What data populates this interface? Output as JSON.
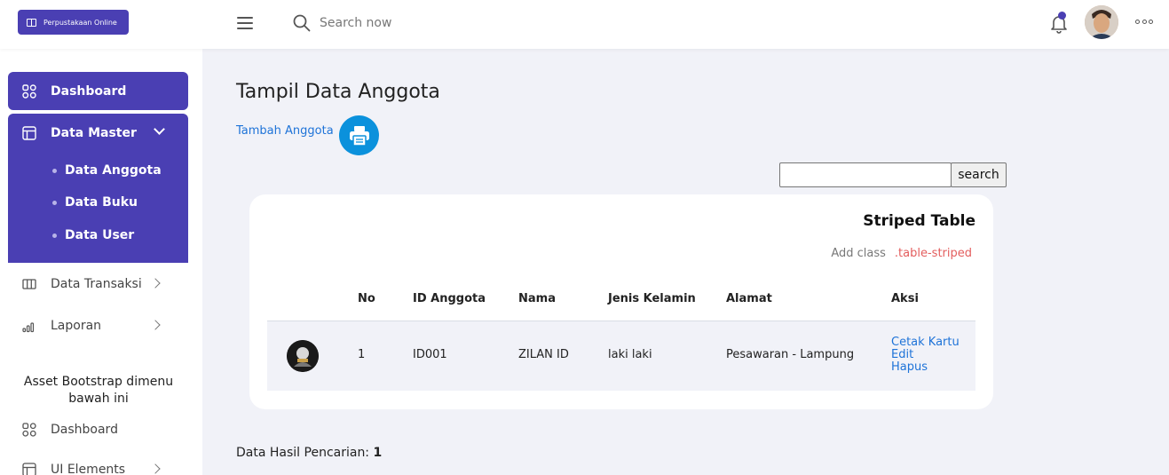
{
  "header": {
    "brand": "Perpustakaan Online",
    "search_placeholder": "Search now"
  },
  "sidebar": {
    "dashboard": "Dashboard",
    "data_master": "Data Master",
    "sub_items": [
      "Data Anggota",
      "Data Buku",
      "Data User"
    ],
    "data_transaksi": "Data Transaksi",
    "laporan": "Laporan",
    "note": "Asset Bootstrap dimenu bawah ini",
    "dashboard2": "Dashboard",
    "ui_elements": "UI Elements"
  },
  "main": {
    "title": "Tampil Data Anggota",
    "add_link": "Tambah Anggota",
    "search_value": "",
    "search_button": "search"
  },
  "card": {
    "title": "Striped Table",
    "sub_label": "Add class",
    "sub_code": ".table-striped",
    "columns": [
      "No",
      "ID Anggota",
      "Nama",
      "Jenis Kelamin",
      "Alamat",
      "Aksi"
    ],
    "rows": [
      {
        "no": "1",
        "id": "ID001",
        "nama": "ZILAN ID",
        "jenis_kelamin": "laki laki",
        "alamat": "Pesawaran - Lampung",
        "actions": [
          "Cetak Kartu",
          "Edit",
          "Hapus"
        ]
      }
    ]
  },
  "result": {
    "label": "Data Hasil Pencarian:",
    "count": "1"
  }
}
